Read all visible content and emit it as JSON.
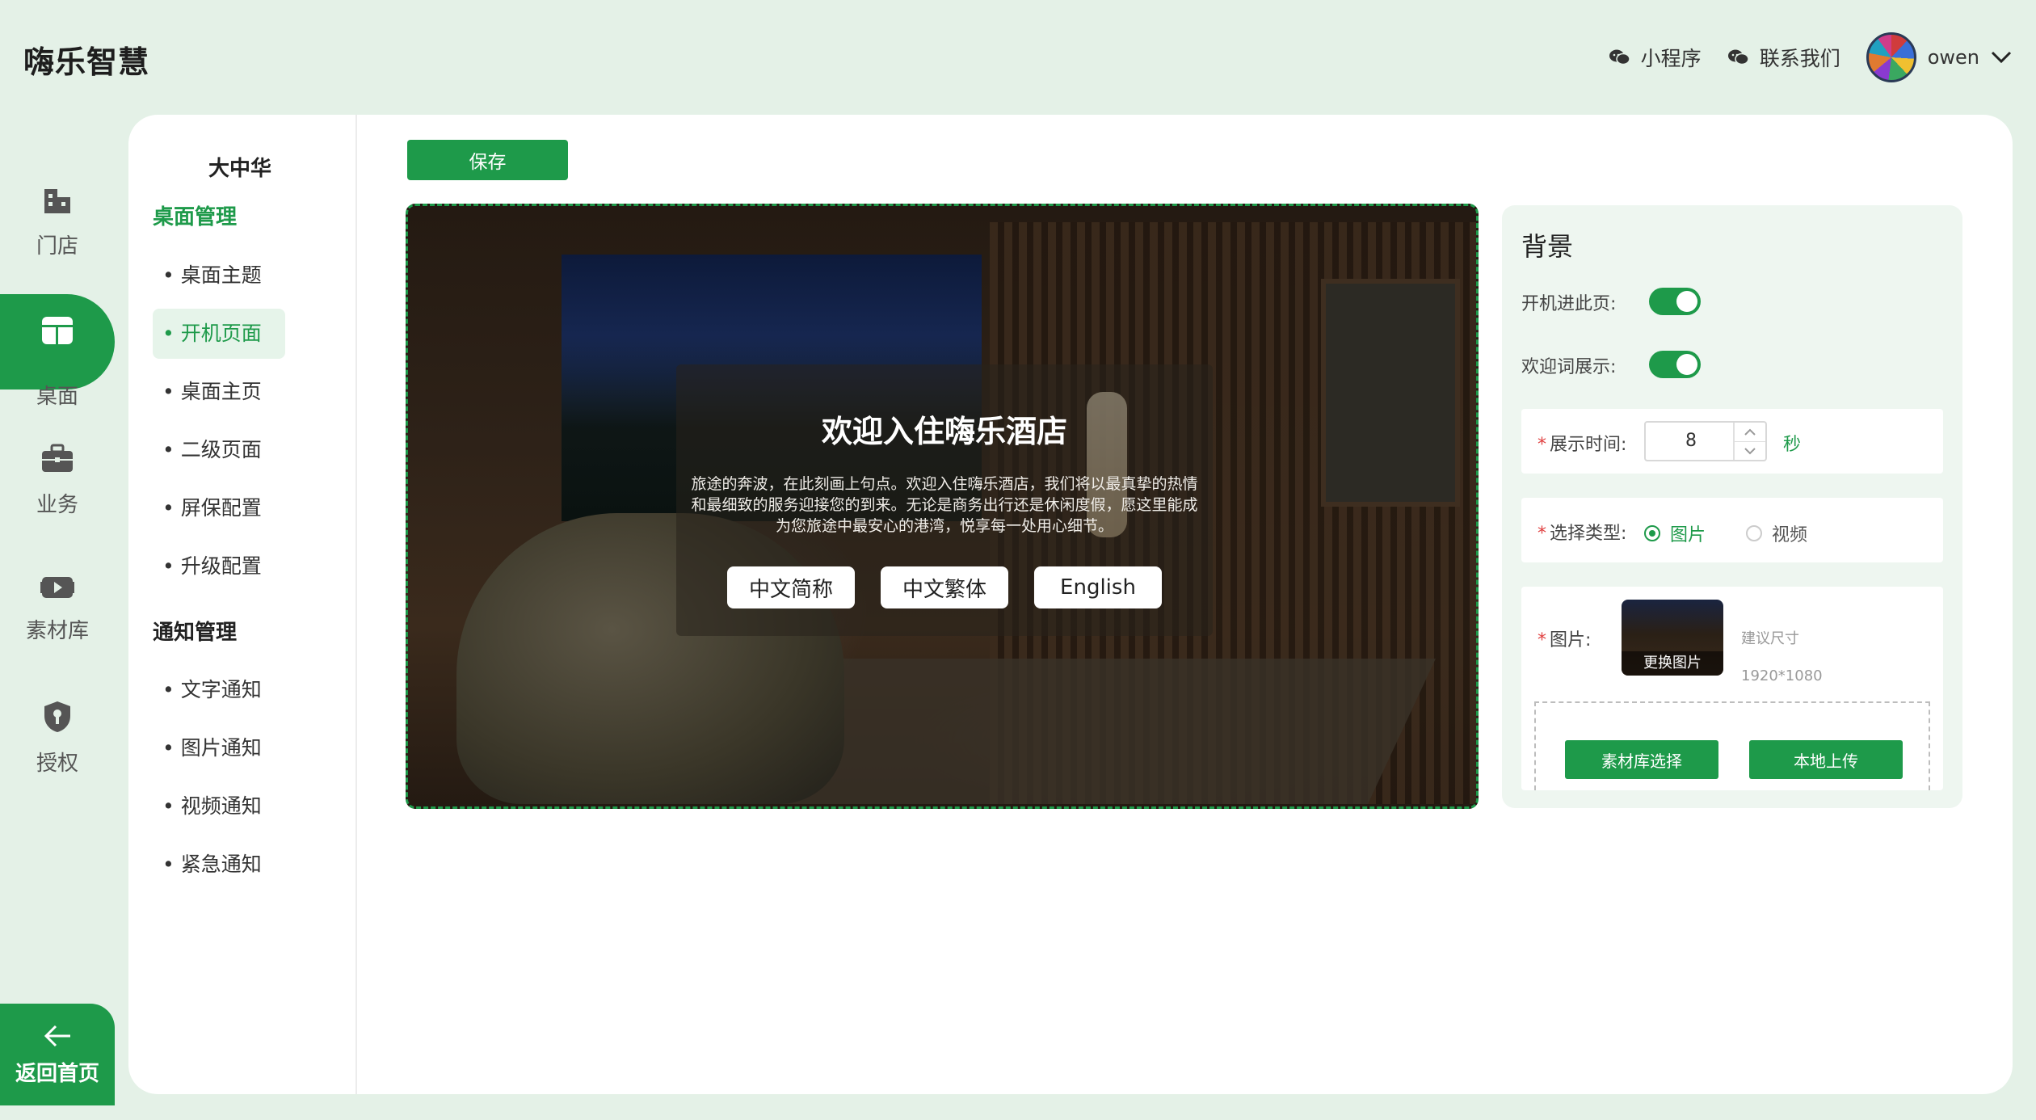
{
  "header": {
    "brand": "嗨乐智慧",
    "mini_program": "小程序",
    "contact_us": "联系我们",
    "user_name": "owen"
  },
  "rail": {
    "items": [
      {
        "label": "门店",
        "icon": "store-icon"
      },
      {
        "label": "桌面",
        "icon": "desktop-icon",
        "active": true
      },
      {
        "label": "业务",
        "icon": "briefcase-icon"
      },
      {
        "label": "素材库",
        "icon": "media-library-icon"
      },
      {
        "label": "授权",
        "icon": "shield-key-icon"
      }
    ],
    "back_home": "返回首页"
  },
  "submenu": {
    "store_name": "大中华",
    "groups": [
      {
        "title": "桌面管理",
        "items": [
          "• 桌面主题",
          "• 开机页面",
          "• 桌面主页",
          "• 二级页面",
          "• 屏保配置",
          "• 升级配置"
        ],
        "active_index": 1
      },
      {
        "title": "通知管理",
        "items": [
          "• 文字通知",
          "• 图片通知",
          "• 视频通知",
          "• 紧急通知"
        ]
      }
    ]
  },
  "toolbar": {
    "save_label": "保存"
  },
  "preview": {
    "title": "欢迎入住嗨乐酒店",
    "text": "旅途的奔波，在此刻画上句点。欢迎入住嗨乐酒店，我们将以最真挚的热情和最细致的服务迎接您的到来。无论是商务出行还是休闲度假，愿这里能成为您旅途中最安心的港湾，悦享每一处用心细节。",
    "languages": [
      "中文简称",
      "中文繁体",
      "English"
    ]
  },
  "settings": {
    "title": "背景",
    "boot_page_label": "开机进此页:",
    "boot_page_on": true,
    "welcome_label": "欢迎词展示:",
    "welcome_on": true,
    "display_time_label": "展示时间:",
    "display_time_value": "8",
    "display_time_unit": "秒",
    "type_label": "选择类型:",
    "type_options": [
      "图片",
      "视频"
    ],
    "type_selected": "图片",
    "image_label": "图片:",
    "change_image": "更换图片",
    "size_hint_label": "建议尺寸",
    "size_hint_value": "1920*1080",
    "library_select": "素材库选择",
    "local_upload": "本地上传"
  },
  "colors": {
    "accent": "#1e9a4a",
    "background": "#e4f1e7",
    "required": "#e04040"
  }
}
